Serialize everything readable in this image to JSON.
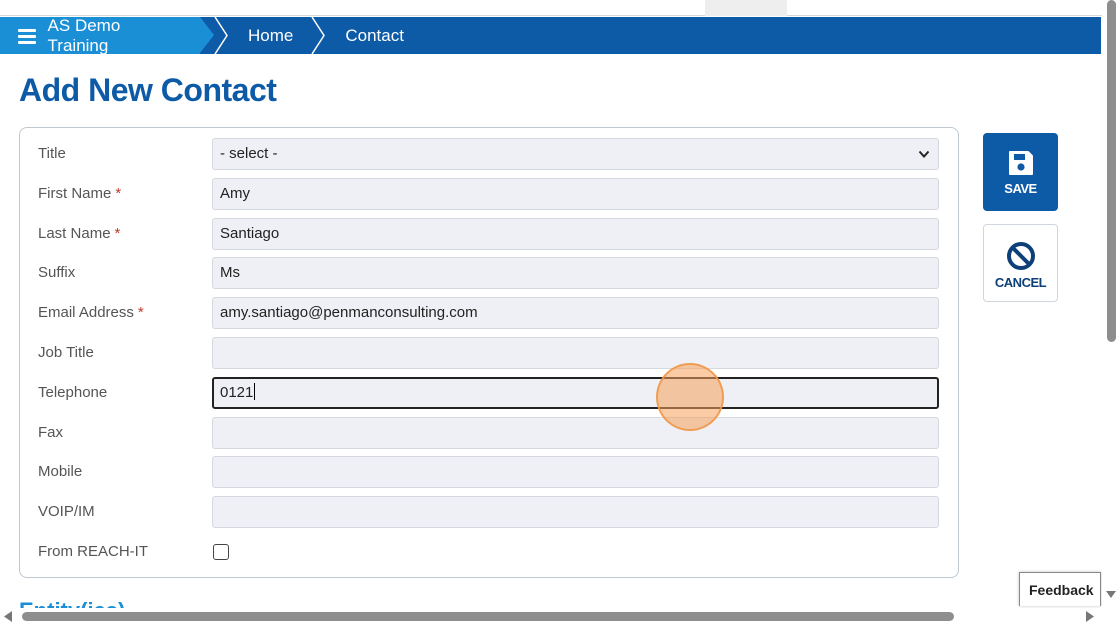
{
  "breadcrumb": {
    "items": [
      "AS Demo Training",
      "Home",
      "Contact"
    ]
  },
  "page_title": "Add New Contact",
  "form": {
    "title": {
      "label": "Title",
      "value": "- select -"
    },
    "first_name": {
      "label": "First Name",
      "required": "*",
      "value": "Amy"
    },
    "last_name": {
      "label": "Last Name",
      "required": "*",
      "value": "Santiago"
    },
    "suffix": {
      "label": "Suffix",
      "value": "Ms"
    },
    "email": {
      "label": "Email Address",
      "required": "*",
      "value": "amy.santiago@penmanconsulting.com"
    },
    "job_title": {
      "label": "Job Title",
      "value": ""
    },
    "telephone": {
      "label": "Telephone",
      "value": "0121"
    },
    "fax": {
      "label": "Fax",
      "value": ""
    },
    "mobile": {
      "label": "Mobile",
      "value": ""
    },
    "voip": {
      "label": "VOIP/IM",
      "value": ""
    },
    "from_reach_it": {
      "label": "From REACH-IT",
      "checked": false
    }
  },
  "actions": {
    "save_label": "SAVE",
    "cancel_label": "CANCEL"
  },
  "feedback_label": "Feedback",
  "next_section_title": "Entity(ies)",
  "colors": {
    "navbar": "#0d5aa7",
    "breadcrumb_first": "#1a8fd6",
    "title": "#0d5aa7",
    "required": "#c0392b"
  },
  "icons": {
    "menu": "hamburger-icon",
    "save": "floppy-disk-icon",
    "cancel": "prohibited-icon",
    "select": "chevron-down-icon"
  }
}
